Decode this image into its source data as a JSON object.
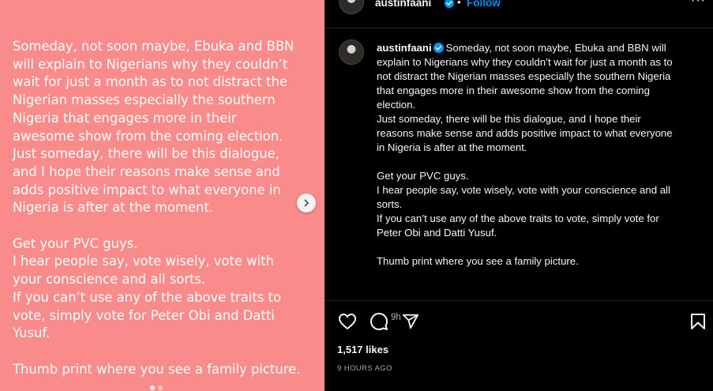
{
  "media": {
    "paragraphs": [
      "Someday, not soon maybe, Ebuka and BBN\nwill explain to Nigerians why they couldn’t\nwait for just a month as to not distract the\nNigerian masses especially the southern\nNigeria that engages more in their\nawesome show from the coming election.\nJust someday, there will be this dialogue,\nand I hope their reasons make sense and\nadds positive impact to what everyone in\nNigeria is after at the moment.",
      "Get your PVC guys.\nI hear people say, vote wisely, vote with\nyour conscience and all sorts.\nIf you can’t use any of the above traits to\nvote, simply vote for Peter Obi and Datti\nYusuf.",
      "Thumb print where you see a family picture."
    ],
    "background_color": "#f98b8b",
    "next_icon": "chevron-right-icon"
  },
  "header": {
    "username": "austinfaani",
    "separator": "•",
    "follow_label": "Follow",
    "more_icon": "more-icon",
    "more_label": "···"
  },
  "post": {
    "username": "austinfaani",
    "caption": "Someday, not soon maybe, Ebuka and BBN will\nexplain to Nigerians why they couldn’t wait for just a month as to\nnot distract the Nigerian masses especially the southern Nigeria\nthat engages more in their awesome show from the coming\nelection.\nJust someday, there will be this dialogue, and I hope their\nreasons make sense and adds positive impact to what everyone\nin Nigeria is after at the moment.\n\nGet your PVC guys.\nI hear people say, vote wisely, vote with your conscience and all\nsorts.\nIf you can’t use any of the above traits to vote, simply vote for\nPeter Obi and Datti Yusuf.\n\nThumb print where you see a family picture.",
    "time_ago": "9h"
  },
  "actions": {
    "icons": [
      "heart-icon",
      "comment-icon",
      "share-icon",
      "bookmark-icon"
    ],
    "likes": "1,517 likes",
    "date": "9 HOURS AGO"
  },
  "colors": {
    "accent": "#0095f6",
    "verified": "#0095f6",
    "muted": "#a8a8a8",
    "divider": "#262626"
  }
}
